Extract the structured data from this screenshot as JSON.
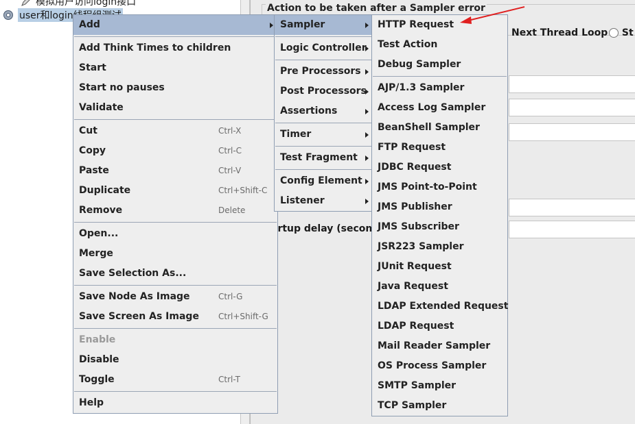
{
  "tree": {
    "items": [
      {
        "label": "模拟用户访问login接口"
      },
      {
        "label": "user和login线程组测试"
      }
    ]
  },
  "panel": {
    "error_group_title": "Action to be taken after a Sampler error",
    "radio_next_thread_loop": "Next Thread Loop",
    "radio_stop_partial": "St",
    "startup_delay_label": "artup delay (seconds"
  },
  "context_menu": {
    "add": "Add",
    "add_think_times": "Add Think Times to children",
    "start": "Start",
    "start_no_pauses": "Start no pauses",
    "validate": "Validate",
    "cut": {
      "label": "Cut",
      "shortcut": "Ctrl-X"
    },
    "copy": {
      "label": "Copy",
      "shortcut": "Ctrl-C"
    },
    "paste": {
      "label": "Paste",
      "shortcut": "Ctrl-V"
    },
    "duplicate": {
      "label": "Duplicate",
      "shortcut": "Ctrl+Shift-C"
    },
    "remove": {
      "label": "Remove",
      "shortcut": "Delete"
    },
    "open": "Open...",
    "merge": "Merge",
    "save_selection_as": "Save Selection As...",
    "save_node_as_image": {
      "label": "Save Node As Image",
      "shortcut": "Ctrl-G"
    },
    "save_screen_as_image": {
      "label": "Save Screen As Image",
      "shortcut": "Ctrl+Shift-G"
    },
    "enable": "Enable",
    "disable": "Disable",
    "toggle": {
      "label": "Toggle",
      "shortcut": "Ctrl-T"
    },
    "help": "Help"
  },
  "add_submenu": {
    "sampler": "Sampler",
    "logic_controller": "Logic Controller",
    "pre_processors": "Pre Processors",
    "post_processors": "Post Processors",
    "assertions": "Assertions",
    "timer": "Timer",
    "test_fragment": "Test Fragment",
    "config_element": "Config Element",
    "listener": "Listener"
  },
  "sampler_submenu": {
    "http_request": "HTTP Request",
    "test_action": "Test Action",
    "debug_sampler": "Debug Sampler",
    "ajp": "AJP/1.3 Sampler",
    "access_log": "Access Log Sampler",
    "beanshell": "BeanShell Sampler",
    "ftp": "FTP Request",
    "jdbc": "JDBC Request",
    "jms_p2p": "JMS Point-to-Point",
    "jms_publisher": "JMS Publisher",
    "jms_subscriber": "JMS Subscriber",
    "jsr223": "JSR223 Sampler",
    "junit": "JUnit Request",
    "java": "Java Request",
    "ldap_extended": "LDAP Extended Request",
    "ldap": "LDAP Request",
    "mail_reader": "Mail Reader Sampler",
    "os_process": "OS Process Sampler",
    "smtp": "SMTP Sampler",
    "tcp": "TCP Sampler"
  },
  "colors": {
    "selection": "#a7b9d3",
    "menu_bg": "#eeeeee",
    "annotation_arrow": "#e02020"
  }
}
